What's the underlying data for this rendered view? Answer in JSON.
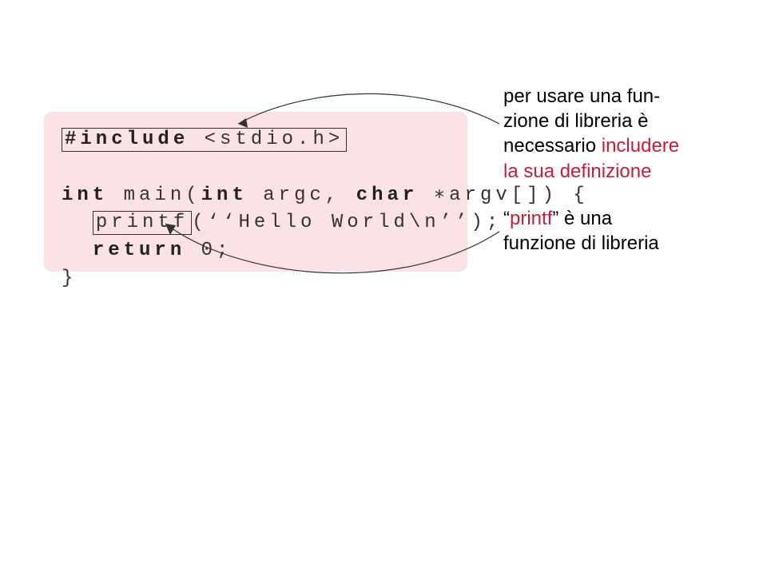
{
  "code": {
    "include_kw": "#include",
    "include_hdr": "<stdio.h>",
    "main_sig_pre": "int",
    "main_sig_mid": " main(",
    "main_sig_int": "int",
    "main_sig_argc": " argc, ",
    "main_sig_char": "char",
    "main_sig_end": " ∗argv[]) {",
    "printf_name": "printf",
    "printf_rest": "(‘‘Hello World\\n’’);",
    "return_kw": "return",
    "return_rest": " 0;",
    "close_brace": "}"
  },
  "annotation1": {
    "t1": "per usare una fun-",
    "t2": "zione di libreria è",
    "t3a": "necessario ",
    "t3b": "includere",
    "t4": "la sua definizione"
  },
  "annotation2": {
    "t1a": "“",
    "t1b": "printf",
    "t1c": "” è una",
    "t2": "funzione di libreria"
  }
}
